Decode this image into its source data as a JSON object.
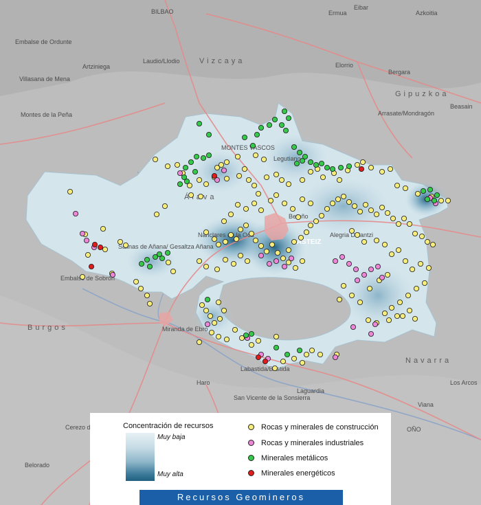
{
  "colors": {
    "construccion": "#f6ec7c",
    "industriales": "#ec86d6",
    "metalicos": "#35c84a",
    "energeticos": "#e01d1d",
    "terrain": "#bdbdbd",
    "province": "#d4e5ec",
    "road": "#e58a8a"
  },
  "places": {
    "bilbao": "BILBAO",
    "ermua": "Ermua",
    "eibar": "Eibar",
    "azkoitia": "Azkoitia",
    "embalse_ordunte": "Embalse de Ordunte",
    "artziniega": "Artziniega",
    "laudio": "Laudio/Llodio",
    "vizcaya": "Vizcaya",
    "elorrio": "Elorrio",
    "bergara": "Bergara",
    "villasana": "Villasana de Mena",
    "arrasate": "Arrasate/Mondragón",
    "beasain": "Beasain",
    "montes_pena": "Montes de la Peña",
    "gipuzkoa": "Gipuzkoa",
    "montes_vascos": "MONTES VASCOS",
    "legutiano": "Legutiano",
    "alava": "Álava",
    "betono": "Betoño",
    "gasteiz": "GASTEIZ",
    "nanclares": "Nanclares de la Oca",
    "alegria": "Alegria Dulantzi",
    "salinas": "Salinas de Añana/ Gesaltza Añana",
    "embalse_sobron": "Embalse de Sobrón",
    "burgos": "Burgos",
    "miranda": "Miranda de Ebro",
    "navarra": "Navarra",
    "haro": "Haro",
    "labastida": "Labastida/Bastida",
    "san_vicente": "San Vicente de la Sonsierra",
    "laguardia": "Laguardia",
    "los_arcos": "Los Arcos",
    "viana": "Viana",
    "cerezo": "Cerezo de Río Tirón",
    "belorado": "Belorado",
    "logrono": "OÑO"
  },
  "legend": {
    "title": "Concentración de recursos",
    "low": "Muy baja",
    "high": "Muy alta",
    "items": [
      {
        "key": "construccion",
        "label": "Rocas y minerales de construcción"
      },
      {
        "key": "industriales",
        "label": "Rocas y minerales industriales"
      },
      {
        "key": "metalicos",
        "label": "Minerales metálicos"
      },
      {
        "key": "energeticos",
        "label": "Minerales energéticos"
      }
    ],
    "footer": "Recursos Geomineros"
  }
}
